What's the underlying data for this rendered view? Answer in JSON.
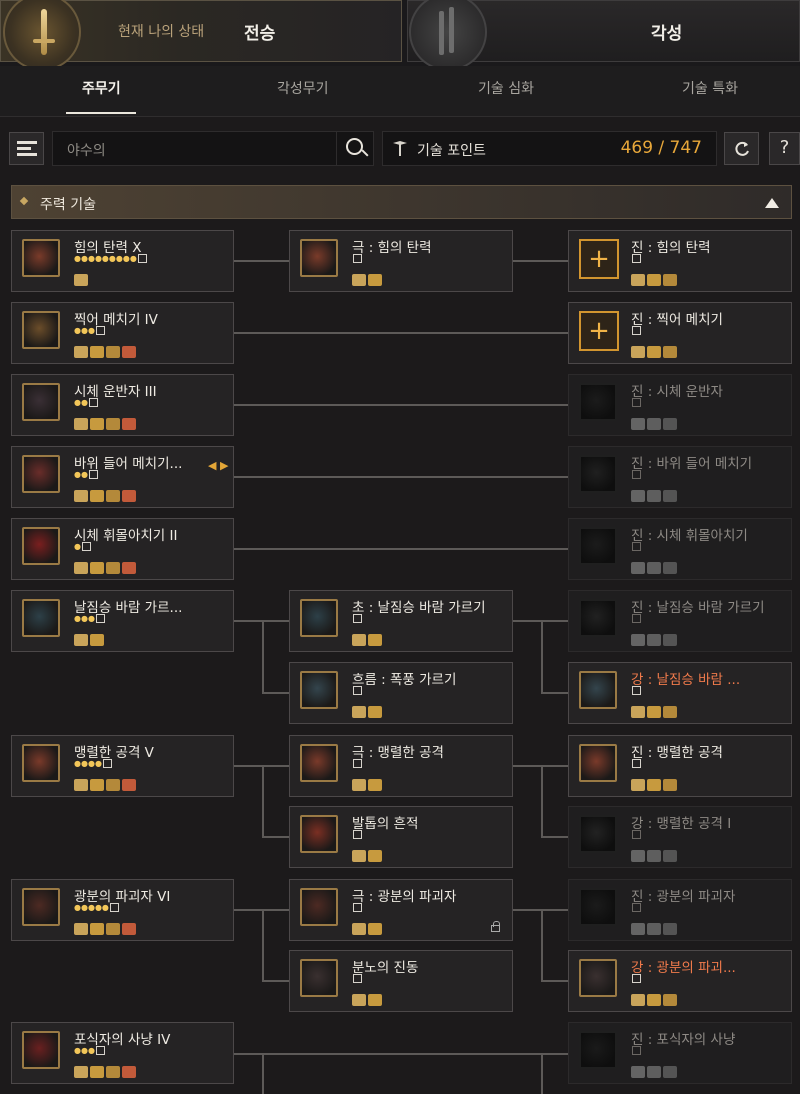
{
  "header": {
    "current_label": "현재 나의 상태",
    "tab_main": "전승",
    "tab_awaken": "각성"
  },
  "subtabs": [
    "주무기",
    "각성무기",
    "기술 심화",
    "기술 특화"
  ],
  "search": {
    "placeholder": "야수의"
  },
  "skill_points": {
    "label": "기술 포인트",
    "value": "469 / 747"
  },
  "help_label": "?",
  "section": {
    "title": "주력 기술"
  },
  "colors": {
    "accent": "#e9a83a",
    "highlight_name": "#f07a4b"
  },
  "rows": [
    {
      "left": {
        "name": "힘의 탄력 X",
        "stars": 9
      },
      "mid": {
        "name": "극 : 힘의 탄력",
        "stars": 0
      },
      "right": {
        "name": "진 : 힘의 탄력",
        "stars": 0,
        "plus": true
      }
    },
    {
      "left": {
        "name": "찍어 메치기 IV",
        "stars": 3
      },
      "right": {
        "name": "진 : 찍어 메치기",
        "stars": 0,
        "plus": true
      }
    },
    {
      "left": {
        "name": "시체 운반자 III",
        "stars": 2
      },
      "right": {
        "name": "진 : 시체 운반자",
        "stars": 0
      }
    },
    {
      "left": {
        "name": "바위 들어 메치기...",
        "stars": 2
      },
      "right": {
        "name": "진 : 바위 들어 메치기",
        "stars": 0
      }
    },
    {
      "left": {
        "name": "시체 휘몰아치기 II",
        "stars": 1
      },
      "right": {
        "name": "진 : 시체 휘몰아치기",
        "stars": 0
      }
    },
    {
      "left": {
        "name": "날짐승 바람 가르...",
        "stars": 3
      },
      "mid": {
        "name": "초 : 날짐승 바람 가르기",
        "stars": 0
      },
      "right": {
        "name": "진 : 날짐승 바람 가르기",
        "stars": 0
      }
    },
    {
      "mid": {
        "name": "흐름 : 폭풍 가르기",
        "stars": 0
      },
      "right": {
        "name": "강 : 날짐승 바람 ...",
        "stars": 0
      }
    },
    {
      "left": {
        "name": "맹렬한 공격 V",
        "stars": 4
      },
      "mid": {
        "name": "극 : 맹렬한 공격",
        "stars": 0
      },
      "right": {
        "name": "진 : 맹렬한 공격",
        "stars": 0
      }
    },
    {
      "mid": {
        "name": "발톱의 흔적",
        "stars": 0
      },
      "right": {
        "name": "강 : 맹렬한 공격 I",
        "stars": 0
      }
    },
    {
      "left": {
        "name": "광분의 파괴자 VI",
        "stars": 5
      },
      "mid": {
        "name": "극 : 광분의 파괴자",
        "stars": 0
      },
      "right": {
        "name": "진 : 광분의 파괴자",
        "stars": 0
      }
    },
    {
      "mid": {
        "name": "분노의 진동",
        "stars": 0
      },
      "right": {
        "name": "강 : 광분의 파괴...",
        "stars": 0
      }
    },
    {
      "left": {
        "name": "포식자의 사냥 IV",
        "stars": 3
      },
      "right": {
        "name": "진 : 포식자의 사냥",
        "stars": 0
      }
    }
  ]
}
